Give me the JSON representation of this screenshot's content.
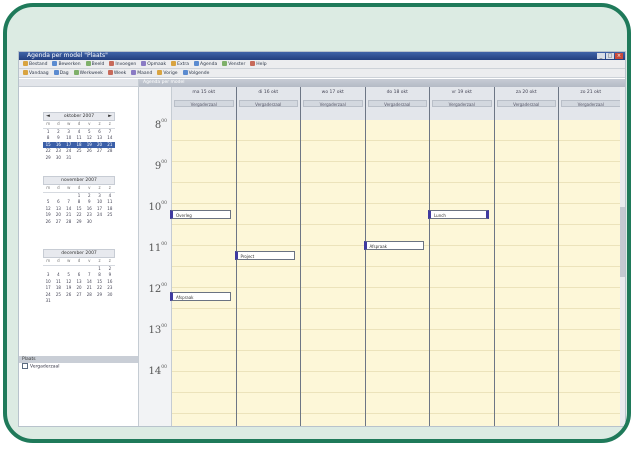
{
  "window": {
    "title": "Agenda per model \"Plaats\""
  },
  "toolbar1": {
    "items": [
      "Bestand",
      "Bewerken",
      "Beeld",
      "Invoegen",
      "Opmaak",
      "Extra",
      "Agenda",
      "Venster",
      "Help"
    ]
  },
  "toolbar2": {
    "items": [
      "Vandaag",
      "Dag",
      "Werkweek",
      "Week",
      "Maand",
      "Vorige",
      "Volgende"
    ]
  },
  "calendar_header": "Agenda per model",
  "months": [
    {
      "label": "oktober 2007",
      "dows": [
        "m",
        "d",
        "w",
        "d",
        "v",
        "z",
        "z"
      ],
      "weeks": [
        [
          "1",
          "2",
          "3",
          "4",
          "5",
          "6",
          "7"
        ],
        [
          "8",
          "9",
          "10",
          "11",
          "12",
          "13",
          "14"
        ],
        [
          "15",
          "16",
          "17",
          "18",
          "19",
          "20",
          "21"
        ],
        [
          "22",
          "23",
          "24",
          "25",
          "26",
          "27",
          "28"
        ],
        [
          "29",
          "30",
          "31",
          "",
          "",
          "",
          ""
        ]
      ],
      "selected_week": 2
    },
    {
      "label": "november 2007",
      "dows": [
        "m",
        "d",
        "w",
        "d",
        "v",
        "z",
        "z"
      ],
      "weeks": [
        [
          "",
          "",
          "",
          "1",
          "2",
          "3",
          "4"
        ],
        [
          "5",
          "6",
          "7",
          "8",
          "9",
          "10",
          "11"
        ],
        [
          "12",
          "13",
          "14",
          "15",
          "16",
          "17",
          "18"
        ],
        [
          "19",
          "20",
          "21",
          "22",
          "23",
          "24",
          "25"
        ],
        [
          "26",
          "27",
          "28",
          "29",
          "30",
          "",
          ""
        ]
      ],
      "selected_week": -1
    },
    {
      "label": "december 2007",
      "dows": [
        "m",
        "d",
        "w",
        "d",
        "v",
        "z",
        "z"
      ],
      "weeks": [
        [
          "",
          "",
          "",
          "",
          "",
          "1",
          "2"
        ],
        [
          "3",
          "4",
          "5",
          "6",
          "7",
          "8",
          "9"
        ],
        [
          "10",
          "11",
          "12",
          "13",
          "14",
          "15",
          "16"
        ],
        [
          "17",
          "18",
          "19",
          "20",
          "21",
          "22",
          "23"
        ],
        [
          "24",
          "25",
          "26",
          "27",
          "28",
          "29",
          "30"
        ],
        [
          "31",
          "",
          "",
          "",
          "",
          "",
          ""
        ]
      ],
      "selected_week": -1
    }
  ],
  "categories": {
    "header": "Plaats",
    "items": [
      "Vergaderzaal"
    ]
  },
  "hours": [
    "8",
    "9",
    "10",
    "11",
    "12",
    "13",
    "14"
  ],
  "hour_minutes": "00",
  "days": [
    {
      "name": "ma 15 okt",
      "resource": "Vergaderzaal"
    },
    {
      "name": "di 16 okt",
      "resource": "Vergaderzaal"
    },
    {
      "name": "wo 17 okt",
      "resource": "Vergaderzaal"
    },
    {
      "name": "do 18 okt",
      "resource": "Vergaderzaal"
    },
    {
      "name": "vr 19 okt",
      "resource": "Vergaderzaal"
    },
    {
      "name": "za 20 okt",
      "resource": "Vergaderzaal"
    },
    {
      "name": "zo 21 okt",
      "resource": "Vergaderzaal"
    }
  ],
  "appointments": [
    {
      "day": 0,
      "hour": 10,
      "label": "Overleg"
    },
    {
      "day": 0,
      "hour": 12,
      "label": "Afspraak"
    },
    {
      "day": 1,
      "hour": 11,
      "label": "Project"
    },
    {
      "day": 3,
      "hour": 10.75,
      "label": "Afspraak"
    },
    {
      "day": 4,
      "hour": 10,
      "label": "Lunch"
    }
  ]
}
